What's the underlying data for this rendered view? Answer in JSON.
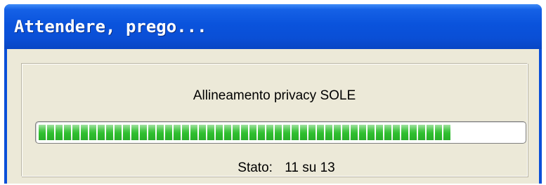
{
  "window": {
    "title": "Attendere, prego..."
  },
  "dialog": {
    "message": "Allineamento privacy SOLE",
    "progress": {
      "fraction": 0.85
    },
    "status": {
      "label": "Stato:",
      "value": "11 su 13"
    }
  },
  "colors": {
    "titlebar": "#0a53dc",
    "client_bg": "#ece9d8",
    "progress_green": "#2fbf2f"
  }
}
